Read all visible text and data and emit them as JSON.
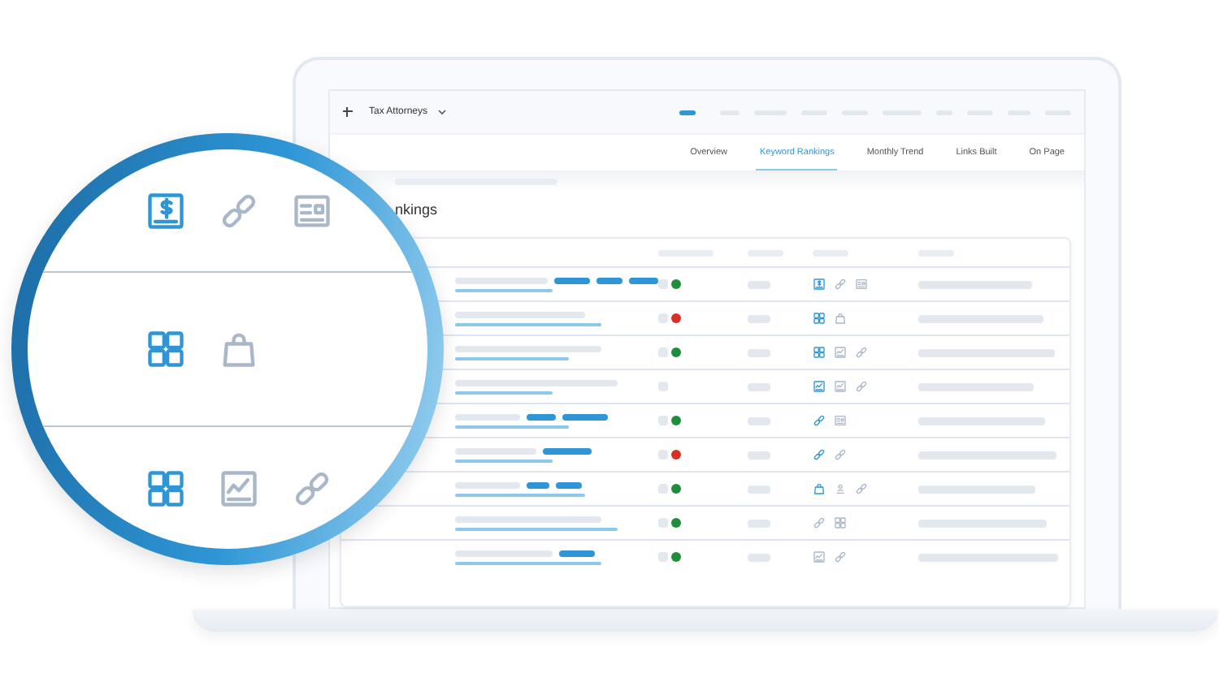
{
  "toolbar": {
    "project": "Tax Attorneys"
  },
  "tabs": [
    {
      "label": "Overview",
      "selected": false
    },
    {
      "label": "Keyword Rankings",
      "selected": true
    },
    {
      "label": "Monthly Trend",
      "selected": false
    },
    {
      "label": "Links Built",
      "selected": false
    },
    {
      "label": "On Page",
      "selected": false
    }
  ],
  "section": {
    "title": "nkings"
  },
  "rows": [
    {
      "color": "#1e8e3e",
      "icons": [
        {
          "kind": "invoice",
          "highlighted": true
        },
        {
          "kind": "link",
          "highlighted": false
        },
        {
          "kind": "card",
          "highlighted": false
        }
      ]
    },
    {
      "color": "#d93025",
      "icons": [
        {
          "kind": "grid",
          "highlighted": true
        },
        {
          "kind": "bag",
          "highlighted": false
        }
      ]
    },
    {
      "color": "#1e8e3e",
      "icons": [
        {
          "kind": "grid",
          "highlighted": true
        },
        {
          "kind": "chart",
          "highlighted": false
        },
        {
          "kind": "link",
          "highlighted": false
        }
      ]
    },
    {
      "icons": [
        {
          "kind": "chart",
          "highlighted": true
        },
        {
          "kind": "chart",
          "highlighted": false
        },
        {
          "kind": "link",
          "highlighted": false
        }
      ]
    },
    {
      "color": "#1e8e3e",
      "icons": [
        {
          "kind": "link",
          "highlighted": true
        },
        {
          "kind": "card",
          "highlighted": false
        }
      ]
    },
    {
      "color": "#d93025",
      "icons": [
        {
          "kind": "link",
          "highlighted": true
        },
        {
          "kind": "link",
          "highlighted": false
        }
      ]
    },
    {
      "color": "#1e8e3e",
      "icons": [
        {
          "kind": "bag",
          "highlighted": true
        },
        {
          "kind": "person",
          "highlighted": false
        },
        {
          "kind": "link",
          "highlighted": false
        }
      ]
    },
    {
      "color": "#1e8e3e",
      "icons": [
        {
          "kind": "link",
          "highlighted": false
        },
        {
          "kind": "grid",
          "highlighted": false
        }
      ]
    },
    {
      "color": "#1e8e3e",
      "icons": [
        {
          "kind": "chart",
          "highlighted": false
        },
        {
          "kind": "link",
          "highlighted": false
        }
      ]
    }
  ],
  "magnifier": {
    "rows": [
      {
        "icons": [
          {
            "kind": "invoice",
            "highlighted": true
          },
          {
            "kind": "link",
            "highlighted": false
          },
          {
            "kind": "card",
            "highlighted": false
          }
        ]
      },
      {
        "icons": [
          {
            "kind": "grid",
            "highlighted": true
          },
          {
            "kind": "bag",
            "highlighted": false
          }
        ]
      },
      {
        "icons": [
          {
            "kind": "grid",
            "highlighted": true
          },
          {
            "kind": "chart",
            "highlighted": false
          },
          {
            "kind": "link",
            "highlighted": false
          }
        ]
      }
    ]
  }
}
